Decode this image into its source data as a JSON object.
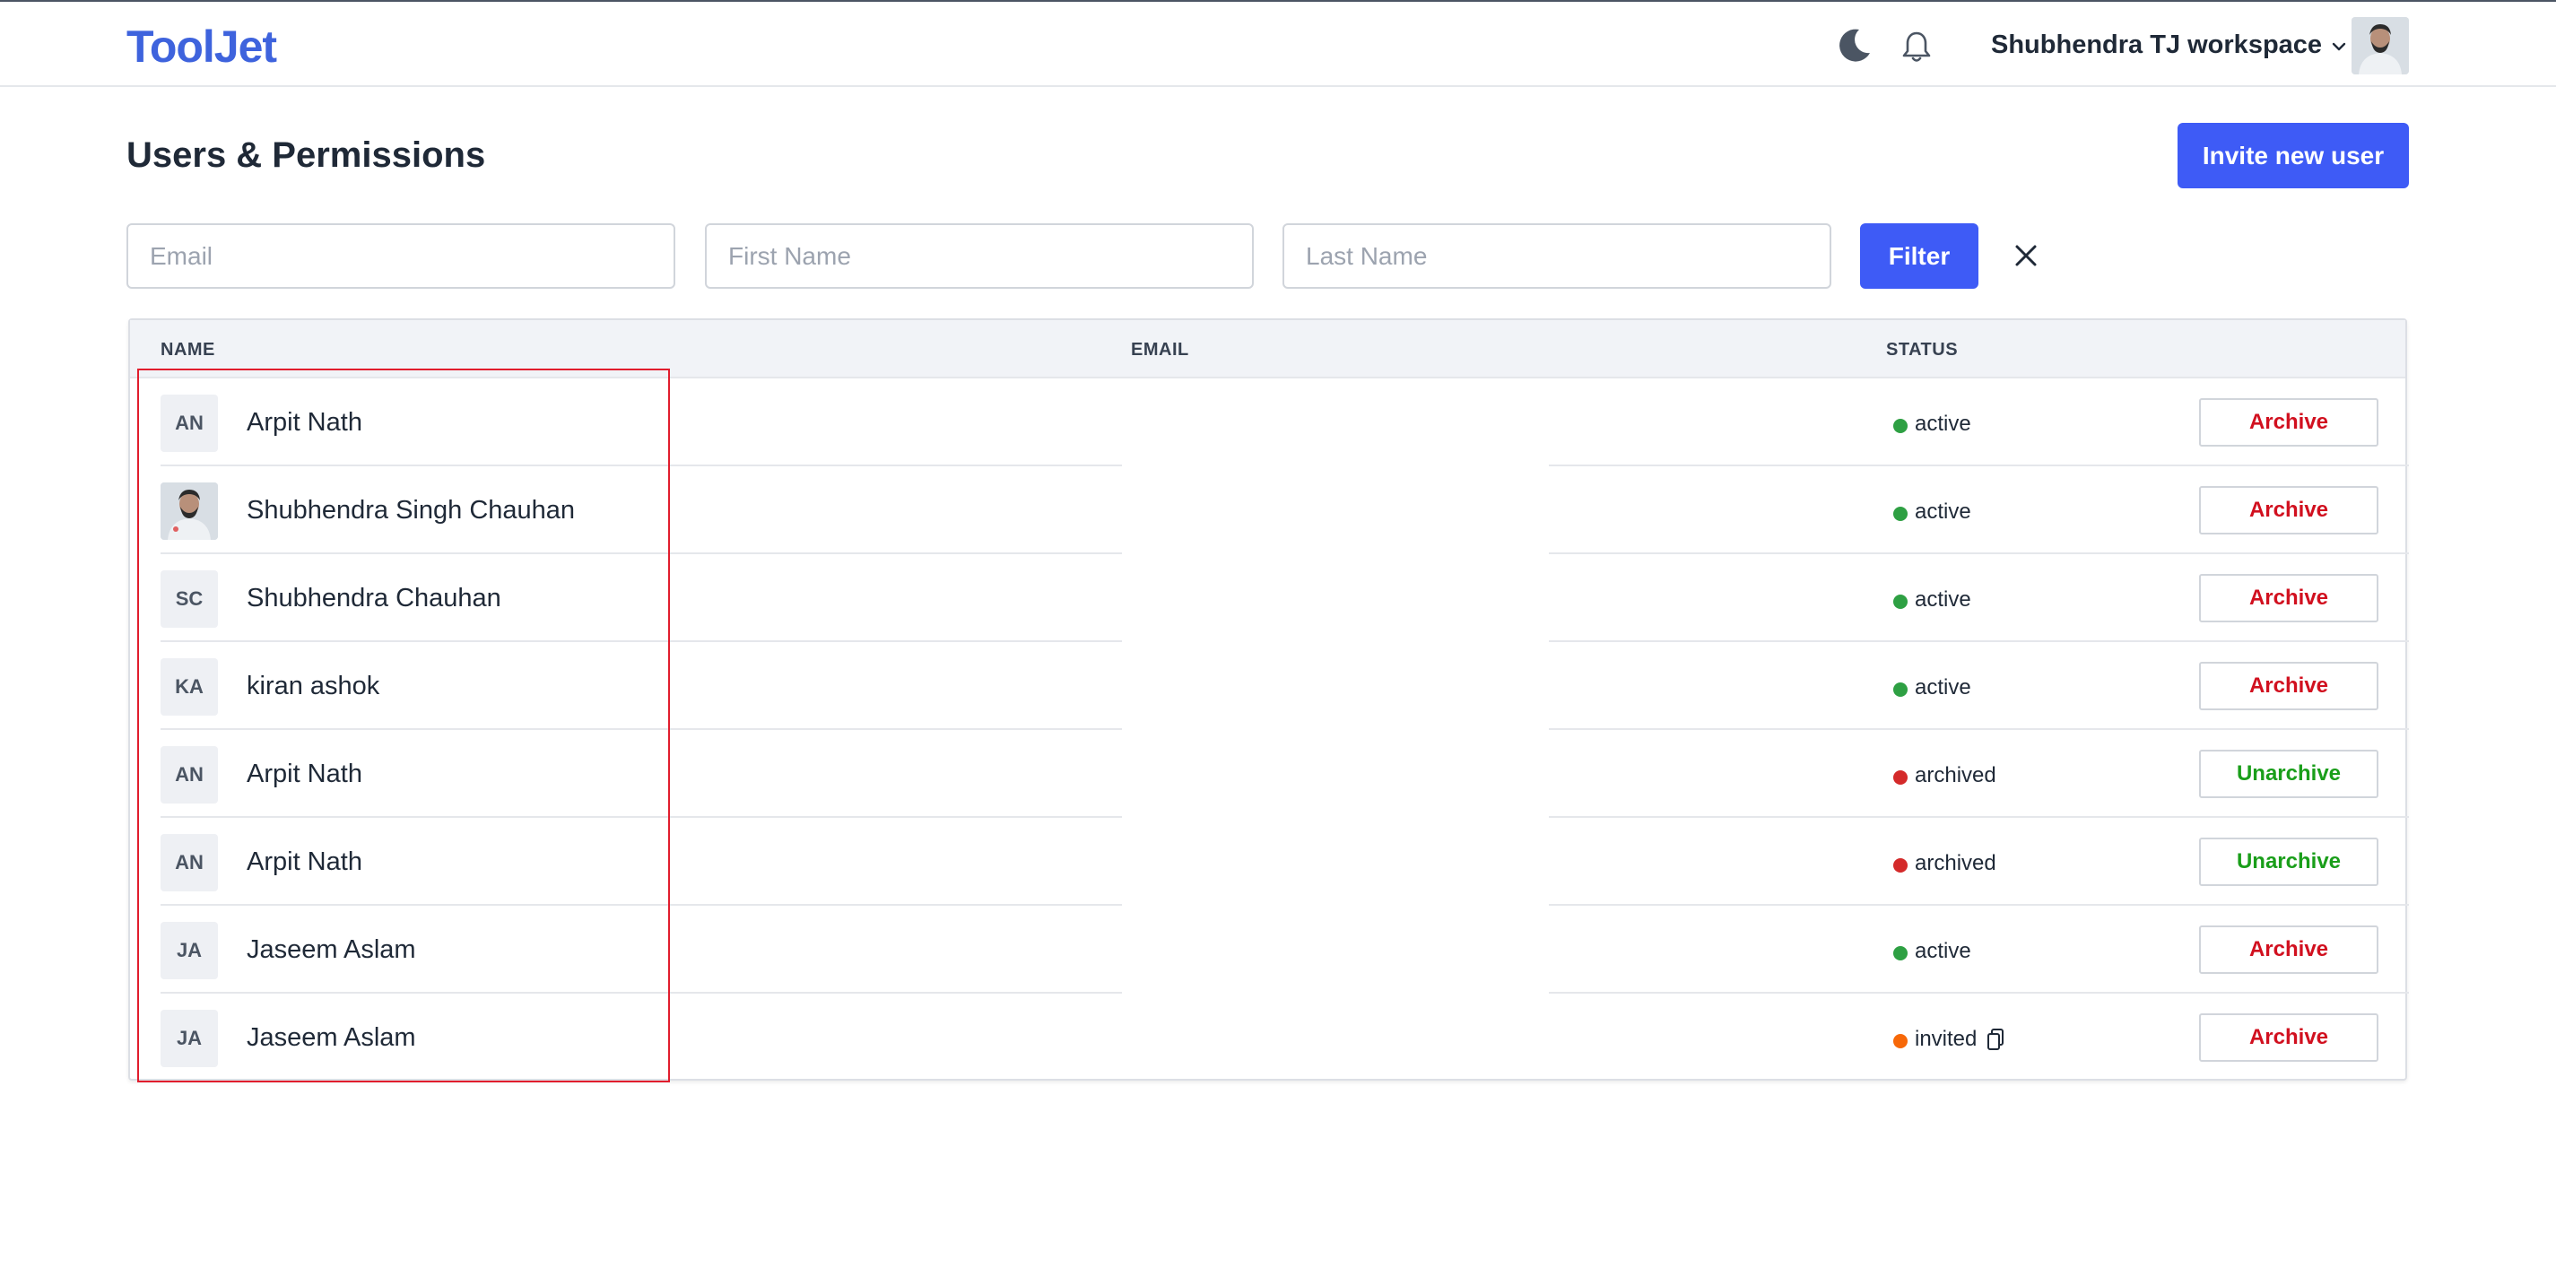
{
  "header": {
    "logo": "ToolJet",
    "workspace": "Shubhendra TJ workspace"
  },
  "page": {
    "title": "Users & Permissions",
    "invite_label": "Invite new user"
  },
  "filters": {
    "email_placeholder": "Email",
    "first_name_placeholder": "First Name",
    "last_name_placeholder": "Last Name",
    "filter_label": "Filter"
  },
  "table": {
    "columns": [
      "NAME",
      "EMAIL",
      "STATUS"
    ],
    "rows": [
      {
        "initials": "AN",
        "name": "Arpit Nath",
        "status": "active",
        "action": "Archive"
      },
      {
        "initials": "",
        "name": "Shubhendra Singh Chauhan",
        "status": "active",
        "action": "Archive"
      },
      {
        "initials": "SC",
        "name": "Shubhendra Chauhan",
        "status": "active",
        "action": "Archive"
      },
      {
        "initials": "KA",
        "name": "kiran ashok",
        "status": "active",
        "action": "Archive"
      },
      {
        "initials": "AN",
        "name": "Arpit Nath",
        "status": "archived",
        "action": "Unarchive"
      },
      {
        "initials": "AN",
        "name": "Arpit Nath",
        "status": "archived",
        "action": "Unarchive"
      },
      {
        "initials": "JA",
        "name": "Jaseem Aslam",
        "status": "active",
        "action": "Archive"
      },
      {
        "initials": "JA",
        "name": "Jaseem Aslam",
        "status": "invited",
        "action": "Archive"
      }
    ]
  },
  "colors": {
    "brand": "#3e63dd",
    "primary_button": "#3e5bf6",
    "status_active": "#2ea043",
    "status_archived": "#d42a2a",
    "status_invited": "#f76808",
    "archive_text": "#d1101f",
    "unarchive_text": "#1a9e1a",
    "highlight": "#e11d2d"
  },
  "icons": {
    "theme_toggle": "moon-icon",
    "notifications": "bell-icon",
    "workspace_dropdown": "chevron-down-icon",
    "clear_filter": "close-icon",
    "copy_invite": "copy-icon"
  }
}
